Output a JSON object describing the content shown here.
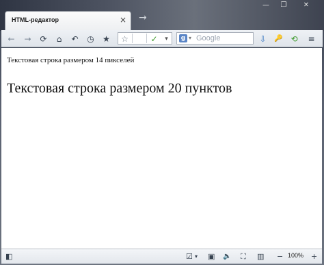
{
  "tab": {
    "title": "HTML-редактор",
    "close_glyph": "×"
  },
  "newtab_glyph": "→",
  "window_buttons": {
    "minimize": "—",
    "restore": "❐",
    "close": "✕"
  },
  "toolbar": {
    "back_icon": "←",
    "forward_icon": "→",
    "reload_icon": "⟳",
    "home_icon": "⌂",
    "undo_icon": "↶",
    "history_icon": "◷",
    "bookmarks_icon": "★",
    "bookmark_add_icon": "☆",
    "url_value": "",
    "go_icon": "✓",
    "dropdown_icon": "▾",
    "search_placeholder": "Google",
    "download_icon": "⇩",
    "key_icon": "🔑",
    "sync_icon": "⟲",
    "menu_icon": "≡"
  },
  "content": {
    "line_small": "Текстовая строка размером 14 пикселей",
    "line_large": "Текстовая строка размером 20 пунктов"
  },
  "statusbar": {
    "sidebar_icon": "◧",
    "check_icon": "☑",
    "screen_icon": "▣",
    "volume_icon": "🔈",
    "fullscreen_icon": "⛶",
    "split_icon": "▥",
    "zoom_out": "−",
    "zoom_level": "100%",
    "zoom_in": "+"
  }
}
